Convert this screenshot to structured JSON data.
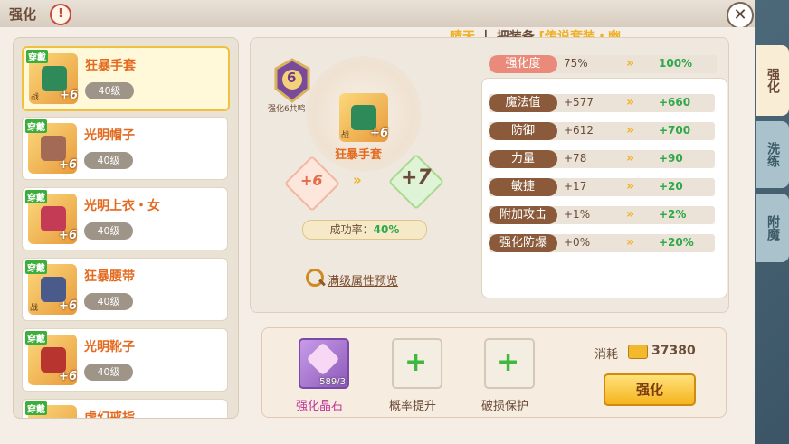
{
  "window": {
    "title": "强化",
    "help_glyph": "!",
    "close_glyph": "✕"
  },
  "header_note": {
    "weather": "晴天",
    "separator": "丨",
    "text": "把装备",
    "highlight": "[传说套装・幽"
  },
  "equipment_list": [
    {
      "tag": "穿戴",
      "plus": "+6",
      "name": "狂暴手套",
      "level": "40级",
      "active": true,
      "color": "#2f8a5a",
      "side": "战"
    },
    {
      "tag": "穿戴",
      "plus": "+6",
      "name": "光明帽子",
      "level": "40级",
      "active": false,
      "color": "#a36b56",
      "side": ""
    },
    {
      "tag": "穿戴",
      "plus": "+6",
      "name": "光明上衣・女",
      "level": "40级",
      "active": false,
      "color": "#c33b54",
      "side": ""
    },
    {
      "tag": "穿戴",
      "plus": "+6",
      "name": "狂暴腰带",
      "level": "40级",
      "active": false,
      "color": "#4a5a8a",
      "side": "战"
    },
    {
      "tag": "穿戴",
      "plus": "+6",
      "name": "光明靴子",
      "level": "40级",
      "active": false,
      "color": "#b8342f",
      "side": ""
    },
    {
      "tag": "穿戴",
      "plus": "",
      "name": "虚幻戒指",
      "level": "",
      "active": false,
      "color": "#d8a040",
      "side": ""
    }
  ],
  "center": {
    "badge_number": "6",
    "badge_label": "强化6共鸣",
    "item_name": "狂暴手套",
    "item_plus": "+6",
    "item_side": "战",
    "from_level": "+6",
    "to_level": "+7",
    "arrow": "»",
    "success_rate_label": "成功率：",
    "success_rate_value": "40%",
    "preview_label": "满级属性预览"
  },
  "enhance_degree": {
    "label": "强化度",
    "current": "75%",
    "next": "100%"
  },
  "stats": [
    {
      "label": "魔法值",
      "current": "+577",
      "next": "+660"
    },
    {
      "label": "防御",
      "current": "+612",
      "next": "+700"
    },
    {
      "label": "力量",
      "current": "+78",
      "next": "+90"
    },
    {
      "label": "敏捷",
      "current": "+17",
      "next": "+20"
    },
    {
      "label": "附加攻击",
      "current": "+1%",
      "next": "+2%"
    },
    {
      "label": "强化防爆",
      "current": "+0%",
      "next": "+20%"
    }
  ],
  "materials": [
    {
      "label": "强化晶石",
      "count": "589/3",
      "icon": "gem-icon"
    },
    {
      "label": "概率提升",
      "icon": "plus-icon"
    },
    {
      "label": "破损保护",
      "icon": "plus-icon"
    }
  ],
  "cost": {
    "label": "消耗",
    "value": "37380",
    "icon": "coin-icon"
  },
  "action": {
    "enhance_label": "强化"
  },
  "tabs": [
    {
      "label": "强化",
      "active": true
    },
    {
      "label": "洗练",
      "active": false
    },
    {
      "label": "附魔",
      "active": false
    }
  ],
  "colors": {
    "accent_orange": "#e36a1f",
    "next_green": "#2fa84a",
    "label_brown": "#8a5a3a"
  }
}
